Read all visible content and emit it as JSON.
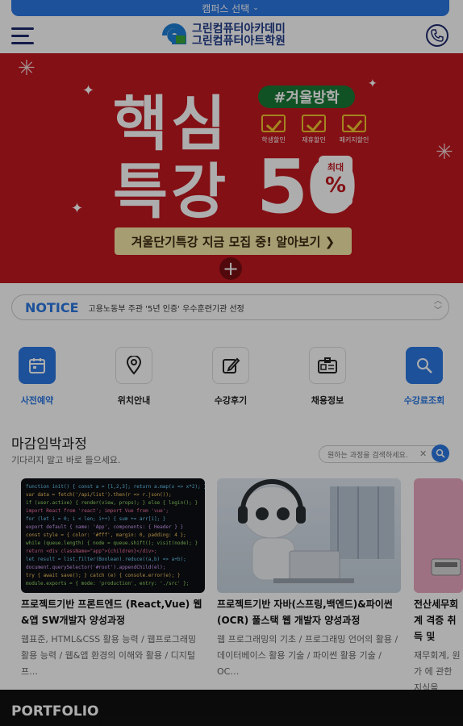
{
  "campus": {
    "label": "캠퍼스 선택"
  },
  "logo": {
    "line1": "그린컴퓨터아카데미",
    "line2": "그린컴퓨터아트학원"
  },
  "banner": {
    "title_line1": "핵심",
    "title_line2": "특강",
    "percent_value": "50",
    "max_label": "최대",
    "percent_sign": "%",
    "tag": "#겨울방학",
    "checks": [
      "학생할인",
      "재휴할인",
      "패키지할인"
    ],
    "cta": "겨울단기특강 지금 모집 중! 알아보기 ❯"
  },
  "notice": {
    "label": "NOTICE",
    "text": "고용노동부 주관 '5년 인증' 우수훈련기관 선정"
  },
  "quick_menu": [
    {
      "label": "사전예약",
      "icon": "calendar-icon",
      "active": true
    },
    {
      "label": "위치안내",
      "icon": "map-pin-icon",
      "active": false
    },
    {
      "label": "수강후기",
      "icon": "edit-icon",
      "active": false
    },
    {
      "label": "채용정보",
      "icon": "id-card-icon",
      "active": false
    },
    {
      "label": "수강료조회",
      "icon": "search-icon",
      "active": true
    }
  ],
  "section": {
    "title": "마감임박과정",
    "subtitle": "기다리지 말고 바로 들으세요.",
    "search_placeholder": "원하는 과정을 검색하세요."
  },
  "courses": [
    {
      "title": "프로젝트기반 프론트엔드 (React,Vue) 웹&앱 SW개발자 양성과정",
      "desc": "웹표준, HTML&CSS 활용 능력 / 웹프로그래밍 활용 능력 / 웹&앱 환경의 이해와 활용 / 디지털 프…"
    },
    {
      "title": "프로젝트기반 자바(스프링,백엔드)&파이썬 (OCR) 풀스택 웹 개발자 양성과정",
      "desc": "웹 프로그래밍의 기초 / 프로그래밍 언어의 활용 / 데이터베이스 활용 기술 / 파이썬 활용 기술 / OC…"
    },
    {
      "title": "전산세무회계 격증 취득 및",
      "desc": "재무회계, 원가 에 관한 지식을"
    }
  ],
  "portfolio": {
    "title": "PORTFOLIO"
  },
  "colors": {
    "brand_blue": "#2b78e4",
    "banner_red": "#c1191f",
    "navy": "#1e2a6e"
  }
}
